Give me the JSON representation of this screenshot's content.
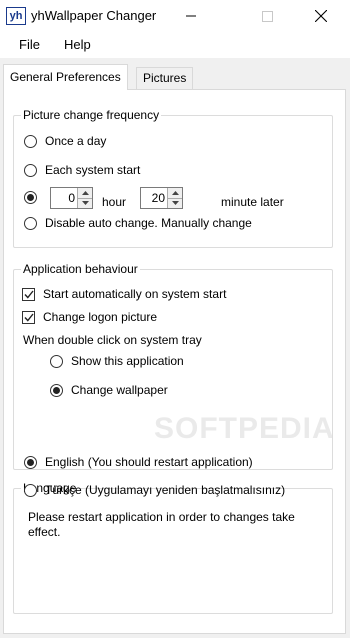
{
  "window": {
    "icon_text": "yh",
    "title": "yhWallpaper Changer"
  },
  "menu": {
    "items": [
      "File",
      "Help"
    ]
  },
  "tabs": [
    "General Preferences",
    "Pictures"
  ],
  "frequency": {
    "title": "Picture change frequency",
    "once_a_day": "Once a day",
    "each_system_start": "Each system start",
    "hour_value": "0",
    "hour_label": "hour",
    "minute_value": "20",
    "minute_label": "minute later",
    "disable": "Disable auto change. Manually change",
    "selected": "custom"
  },
  "behaviour": {
    "title": "Application behaviour",
    "start_auto": "Start automatically on system start",
    "start_auto_checked": true,
    "change_logon": "Change logon picture",
    "change_logon_checked": true,
    "tray_label": "When double click on system tray",
    "show_app": "Show this application",
    "change_wallpaper": "Change wallpaper",
    "selected": "change_wallpaper"
  },
  "language": {
    "title": "Language",
    "english": "English (You should restart application)",
    "turkish": "Türkçe (Uygulamayı yeniden başlatmalısınız)",
    "selected": "english",
    "note": "Please restart application in order to changes take effect."
  },
  "watermark": "SOFTPEDIA"
}
